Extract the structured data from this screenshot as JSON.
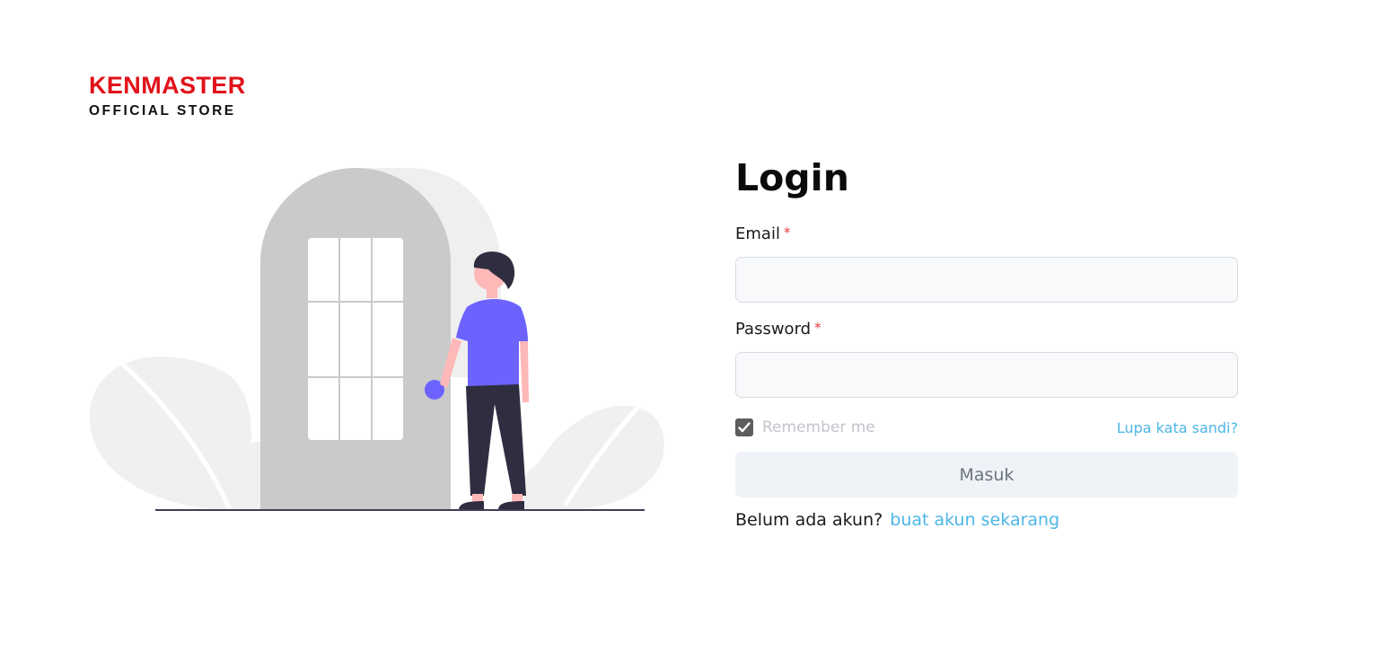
{
  "brand": {
    "name": "KENMASTER",
    "subtitle": "OFFICIAL STORE",
    "brand_color": "#e1121a"
  },
  "illustration": {
    "icon": "person-at-door-illustration"
  },
  "login": {
    "title": "Login",
    "email_label": "Email",
    "password_label": "Password",
    "required_marker": "*",
    "email_value": "",
    "password_value": "",
    "remember_label": "Remember me",
    "remember_checked": true,
    "forgot_link": "Lupa kata sandi?",
    "submit_label": "Masuk",
    "register_prompt": "Belum ada akun?",
    "register_link": "buat akun sekarang"
  },
  "colors": {
    "link": "#4db6e8",
    "required": "#e63b3b",
    "button_bg": "#eff2f6"
  }
}
